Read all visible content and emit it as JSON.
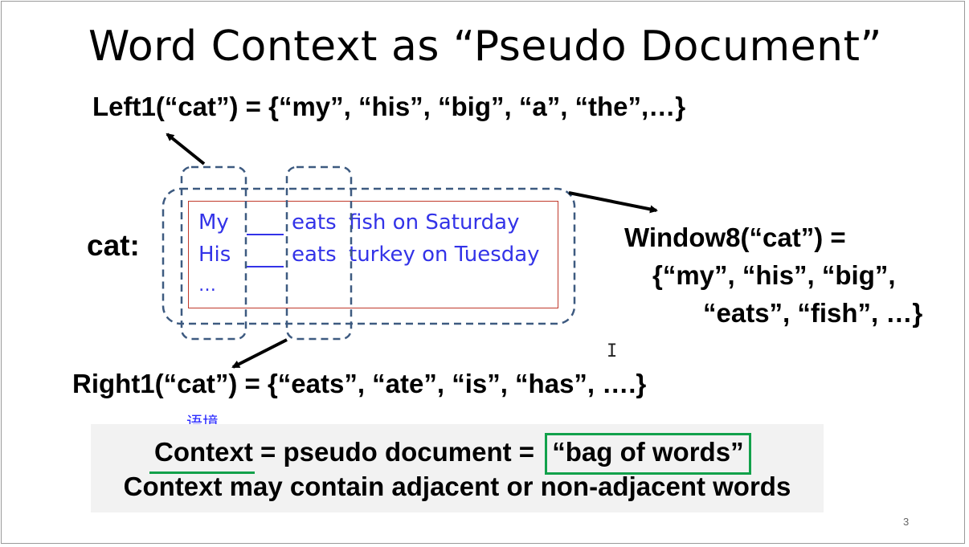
{
  "slide": {
    "title": "Word Context as “Pseudo Document”",
    "left1": "Left1(“cat”) = {“my”, “his”, “big”, “a”, “the”,…}",
    "right1": "Right1(“cat”) = {“eats”, “ate”, “is”, “has”, ….}",
    "cat_label": "cat:",
    "window": {
      "line1": "Window8(“cat”)  =",
      "line2": "{“my”, “his”, “big”,",
      "line3": "“eats”,  “fish”, …}"
    },
    "sentences": {
      "row1_w1": "My",
      "row1_w2": "eats",
      "row1_w3": "fish on Saturday",
      "row2_w1": "His",
      "row2_w2": "eats",
      "row2_w3": "turkey on Tuesday",
      "row3": "…"
    },
    "annotation_cn": "语境",
    "summary": {
      "word_context": "Context",
      "middle": " = pseudo document = ",
      "boxed": "“bag of words”",
      "line2": "Context may contain adjacent or non-adjacent words"
    },
    "page_number": "3",
    "cursor_glyph": "I"
  },
  "colors": {
    "sentence_text": "#3333e8",
    "dashed_box": "#3d5a80",
    "red_box": "#c0392b",
    "green_accent": "#12a14b",
    "panel_bg": "#f2f2f2"
  }
}
